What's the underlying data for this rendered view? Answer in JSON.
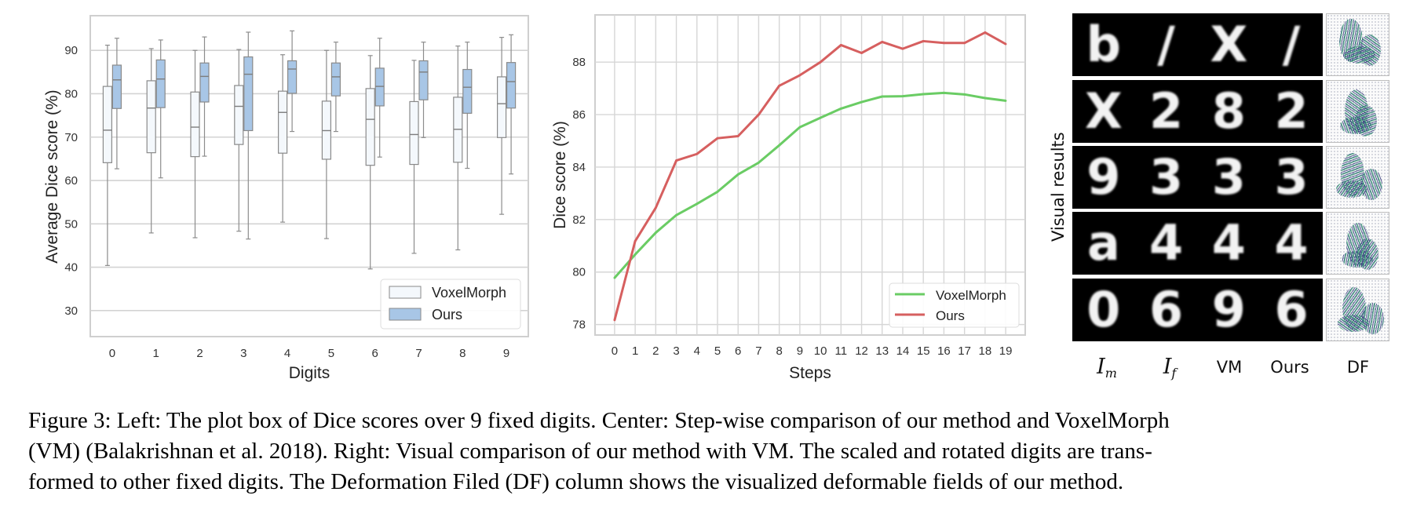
{
  "figure": {
    "caption_lines": [
      "Figure 3: Left: The plot box of Dice scores over 9 fixed digits. Center: Step-wise comparison of our method and VoxelMorph",
      "(VM) (Balakrishnan et al. 2018). Right: Visual comparison of our method with VM. The scaled and rotated digits are trans-",
      "formed to other fixed digits. The Deformation Filed (DF) column shows the visualized deformable fields of our method."
    ]
  },
  "chart_data": [
    {
      "type": "box",
      "title": "",
      "xlabel": "Digits",
      "ylabel": "Average Dice score (%)",
      "categories": [
        "0",
        "1",
        "2",
        "3",
        "4",
        "5",
        "6",
        "7",
        "8",
        "9"
      ],
      "yticks": [
        30,
        40,
        50,
        60,
        70,
        80,
        90
      ],
      "ylim": [
        24,
        98
      ],
      "grid": "horizontal",
      "legend_position": "bottom-right",
      "series": [
        {
          "name": "VoxelMorph",
          "color": "#f4f8fc",
          "stats": [
            {
              "whislo": 40.4,
              "q1": 64.1,
              "med": 71.6,
              "q3": 81.7,
              "whishi": 91.2
            },
            {
              "whislo": 47.9,
              "q1": 66.4,
              "med": 76.7,
              "q3": 83.0,
              "whishi": 90.4
            },
            {
              "whislo": 46.8,
              "q1": 65.5,
              "med": 72.3,
              "q3": 80.4,
              "whishi": 90.0
            },
            {
              "whislo": 48.3,
              "q1": 68.3,
              "med": 77.1,
              "q3": 81.9,
              "whishi": 90.2
            },
            {
              "whislo": 50.4,
              "q1": 66.3,
              "med": 75.7,
              "q3": 80.6,
              "whishi": 89.0
            },
            {
              "whislo": 46.6,
              "q1": 64.9,
              "med": 71.5,
              "q3": 78.3,
              "whishi": 90.0
            },
            {
              "whislo": 39.6,
              "q1": 63.5,
              "med": 74.1,
              "q3": 81.2,
              "whishi": 88.8
            },
            {
              "whislo": 43.2,
              "q1": 63.7,
              "med": 70.6,
              "q3": 78.2,
              "whishi": 87.7
            },
            {
              "whislo": 44.0,
              "q1": 64.2,
              "med": 71.8,
              "q3": 79.2,
              "whishi": 91.0
            },
            {
              "whislo": 52.2,
              "q1": 69.9,
              "med": 77.7,
              "q3": 83.9,
              "whishi": 93.0
            }
          ]
        },
        {
          "name": "Ours",
          "color": "#a8c6e6",
          "stats": [
            {
              "whislo": 62.7,
              "q1": 76.6,
              "med": 83.2,
              "q3": 86.6,
              "whishi": 92.8
            },
            {
              "whislo": 60.6,
              "q1": 76.8,
              "med": 83.4,
              "q3": 87.8,
              "whishi": 92.4
            },
            {
              "whislo": 65.6,
              "q1": 78.1,
              "med": 84.0,
              "q3": 87.1,
              "whishi": 93.1
            },
            {
              "whislo": 46.5,
              "q1": 71.5,
              "med": 84.5,
              "q3": 88.5,
              "whishi": 94.2
            },
            {
              "whislo": 71.3,
              "q1": 80.1,
              "med": 85.7,
              "q3": 87.6,
              "whishi": 94.5
            },
            {
              "whislo": 71.3,
              "q1": 79.5,
              "med": 83.9,
              "q3": 87.1,
              "whishi": 91.9
            },
            {
              "whislo": 65.4,
              "q1": 77.2,
              "med": 81.7,
              "q3": 85.9,
              "whishi": 92.8
            },
            {
              "whislo": 69.9,
              "q1": 78.6,
              "med": 85.0,
              "q3": 87.6,
              "whishi": 91.9
            },
            {
              "whislo": 62.8,
              "q1": 75.5,
              "med": 81.5,
              "q3": 85.6,
              "whishi": 91.9
            },
            {
              "whislo": 61.5,
              "q1": 76.7,
              "med": 82.8,
              "q3": 87.2,
              "whishi": 93.6
            }
          ]
        }
      ]
    },
    {
      "type": "line",
      "title": "",
      "xlabel": "Steps",
      "ylabel": "Dice score (%)",
      "x": [
        0,
        1,
        2,
        3,
        4,
        5,
        6,
        7,
        8,
        9,
        10,
        11,
        12,
        13,
        14,
        15,
        16,
        17,
        18,
        19
      ],
      "yticks": [
        78,
        80,
        82,
        84,
        86,
        88
      ],
      "ylim": [
        77.6,
        89.8
      ],
      "xlim": [
        -0.95,
        19.95
      ],
      "grid": "both",
      "legend_position": "bottom-right",
      "series": [
        {
          "name": "VoxelMorph",
          "color": "#6acc64",
          "values": [
            79.78,
            80.67,
            81.5,
            82.17,
            82.6,
            83.06,
            83.72,
            84.17,
            84.83,
            85.52,
            85.88,
            86.23,
            86.48,
            86.69,
            86.7,
            86.78,
            86.83,
            86.77,
            86.63,
            86.53
          ]
        },
        {
          "name": "Ours",
          "color": "#d65f5f",
          "values": [
            78.17,
            81.18,
            82.45,
            84.25,
            84.5,
            85.1,
            85.18,
            86.0,
            87.1,
            87.5,
            88.0,
            88.65,
            88.35,
            88.77,
            88.51,
            88.8,
            88.73,
            88.73,
            89.13,
            88.69
          ]
        }
      ]
    }
  ],
  "visual_results": {
    "row_label": "Visual results",
    "column_labels": [
      {
        "main": "I",
        "sub": "m",
        "math": true
      },
      {
        "main": "I",
        "sub": "f",
        "math": true
      },
      {
        "main": "VM",
        "sub": "",
        "math": false
      },
      {
        "main": "Ours",
        "sub": "",
        "math": false
      },
      {
        "main": "DF",
        "sub": "",
        "math": false
      }
    ],
    "rows": [
      {
        "moving": "b",
        "fixed": "/",
        "vm": "X",
        "ours": "/"
      },
      {
        "moving": "X",
        "fixed": "2",
        "vm": "8",
        "ours": "2"
      },
      {
        "moving": "9",
        "fixed": "3",
        "vm": "3",
        "ours": "3"
      },
      {
        "moving": "a",
        "fixed": "4",
        "vm": "4",
        "ours": "4"
      },
      {
        "moving": "0",
        "fixed": "6",
        "vm": "9",
        "ours": "6"
      }
    ]
  }
}
